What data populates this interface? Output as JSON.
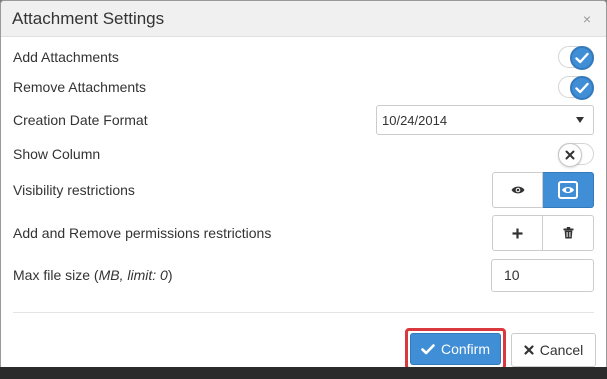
{
  "dialog": {
    "title": "Attachment Settings",
    "close_glyph": "×"
  },
  "settings": {
    "add_attachments": {
      "label": "Add Attachments",
      "enabled": true
    },
    "remove_attachments": {
      "label": "Remove Attachments",
      "enabled": true
    },
    "creation_date_format": {
      "label": "Creation Date Format",
      "value": "10/24/2014"
    },
    "show_column": {
      "label": "Show Column",
      "enabled": false
    },
    "visibility_restrictions": {
      "label": "Visibility restrictions",
      "options": [
        {
          "icon": "eye-icon",
          "active": false
        },
        {
          "icon": "eye-boxed-icon",
          "active": true
        }
      ]
    },
    "permissions_restrictions": {
      "label": "Add and Remove permissions restrictions",
      "options": [
        {
          "icon": "plus-icon"
        },
        {
          "icon": "trash-icon"
        }
      ]
    },
    "max_file_size": {
      "label_prefix": "Max file size (",
      "label_unit": "MB, limit: 0",
      "label_suffix": ")",
      "value": "10"
    }
  },
  "footer": {
    "confirm_label": "Confirm",
    "cancel_label": "Cancel"
  },
  "colors": {
    "accent": "#3f8ed6",
    "highlight_border": "#d9383f",
    "header_bg": "#f0f0f0"
  }
}
